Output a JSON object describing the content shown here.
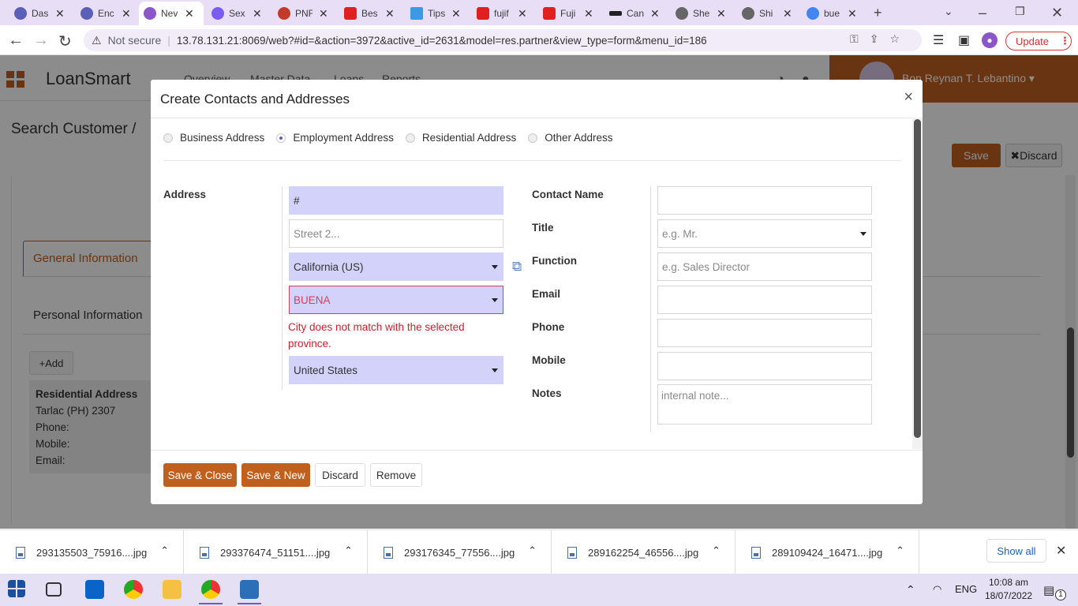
{
  "browser": {
    "tabs": [
      {
        "title": "Das",
        "favicon_color": "#5b5fb8"
      },
      {
        "title": "Enc",
        "favicon_color": "#5b5fb8"
      },
      {
        "title": "Nev",
        "favicon_color": "#8a56c8",
        "active": true
      },
      {
        "title": "Sex",
        "favicon_color": "#7b5cf0"
      },
      {
        "title": "PNF",
        "favicon_color": "#c23a2a"
      },
      {
        "title": "Bes",
        "favicon_color": "#e02020"
      },
      {
        "title": "Tips",
        "favicon_color": "#3a9ae8"
      },
      {
        "title": "fujif",
        "favicon_color": "#e02020"
      },
      {
        "title": "Fuji",
        "favicon_color": "#e02020"
      },
      {
        "title": "Can",
        "favicon_color": "#222222"
      },
      {
        "title": "She",
        "favicon_color": "#666666"
      },
      {
        "title": "Shi",
        "favicon_color": "#666666"
      },
      {
        "title": "bue",
        "favicon_color": "#4285f4"
      }
    ],
    "new_tab": "+",
    "not_secure": "Not secure",
    "url": "13.78.131.21:8069/web?#id=&action=3972&active_id=2631&model=res.partner&view_type=form&menu_id=186",
    "update_label": "Update"
  },
  "app": {
    "title": "LoanSmart",
    "menu": [
      "Overview",
      "Master Data",
      "Loans",
      "Reports"
    ],
    "user": "Bon Reynan T. Lebantino",
    "breadcrumb": "Search Customer /",
    "save": "Save",
    "discard": "Discard",
    "tab_general": "General Information",
    "personal_info": "Personal Information",
    "add": "Add",
    "card": {
      "title": "Residential Address",
      "line1": "Tarlac (PH) 2307",
      "phone": "Phone:",
      "mobile": "Mobile:",
      "email": "Email:"
    }
  },
  "modal": {
    "title": "Create Contacts and Addresses",
    "close": "×",
    "address_types": [
      {
        "label": "Business Address",
        "selected": false
      },
      {
        "label": "Employment Address",
        "selected": true
      },
      {
        "label": "Residential Address",
        "selected": false
      },
      {
        "label": "Other Address",
        "selected": false
      }
    ],
    "address_label": "Address",
    "street": "#",
    "street2_placeholder": "Street 2...",
    "state": "California (US)",
    "city": "BUENA",
    "city_error": "City does not match with the selected province.",
    "country": "United States",
    "contact_name_label": "Contact Name",
    "title_label": "Title",
    "title_placeholder": "e.g. Mr.",
    "function_label": "Function",
    "function_placeholder": "e.g. Sales Director",
    "email_label": "Email",
    "phone_label": "Phone",
    "mobile_label": "Mobile",
    "notes_label": "Notes",
    "notes_placeholder": "internal note...",
    "buttons": {
      "save_close": "Save & Close",
      "save_new": "Save & New",
      "discard": "Discard",
      "remove": "Remove"
    }
  },
  "downloads": {
    "files": [
      "293135503_75916....jpg",
      "293376474_51151....jpg",
      "293176345_77556....jpg",
      "289162254_46556....jpg",
      "289109424_16471....jpg"
    ],
    "show_all": "Show all"
  },
  "taskbar": {
    "lang": "ENG",
    "time": "10:08 am",
    "date": "18/07/2022",
    "notification_count": "1"
  }
}
